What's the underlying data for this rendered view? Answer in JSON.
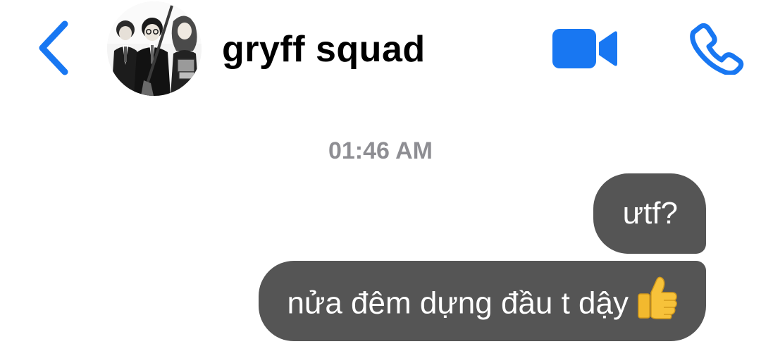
{
  "header": {
    "back_icon": "chevron-left-icon",
    "avatar_icon": "group-avatar",
    "title": "gryff squad",
    "video_icon": "video-camera-icon",
    "phone_icon": "phone-icon",
    "accent_color": "#1877F2"
  },
  "thread": {
    "timestamp": "01:46 AM",
    "messages": [
      {
        "text": "ưtf?",
        "sender": "me"
      },
      {
        "text": "nửa đêm dựng đầu t dậy",
        "emoji": "thumbs-up-icon",
        "sender": "me"
      }
    ],
    "bubble_color": "#555555",
    "text_color": "#FFFFFF",
    "timestamp_color": "#8E8E93"
  }
}
